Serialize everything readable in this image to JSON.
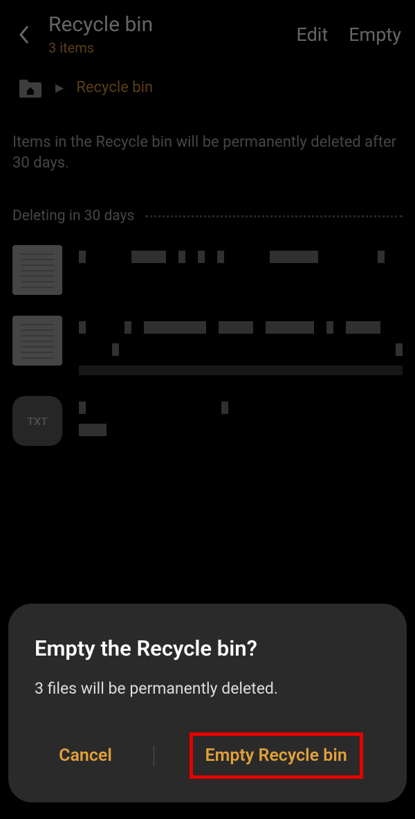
{
  "header": {
    "title": "Recycle bin",
    "subtitle": "3 items",
    "edit_label": "Edit",
    "empty_label": "Empty"
  },
  "breadcrumb": {
    "current": "Recycle bin"
  },
  "info_text": "Items in the Recycle bin will be permanently deleted after 30 days.",
  "section": {
    "title": "Deleting in 30 days"
  },
  "files": {
    "txt_badge": "TXT"
  },
  "dialog": {
    "title": "Empty the Recycle bin?",
    "message": "3 files will be permanently deleted.",
    "cancel_label": "Cancel",
    "confirm_label": "Empty Recycle bin"
  }
}
